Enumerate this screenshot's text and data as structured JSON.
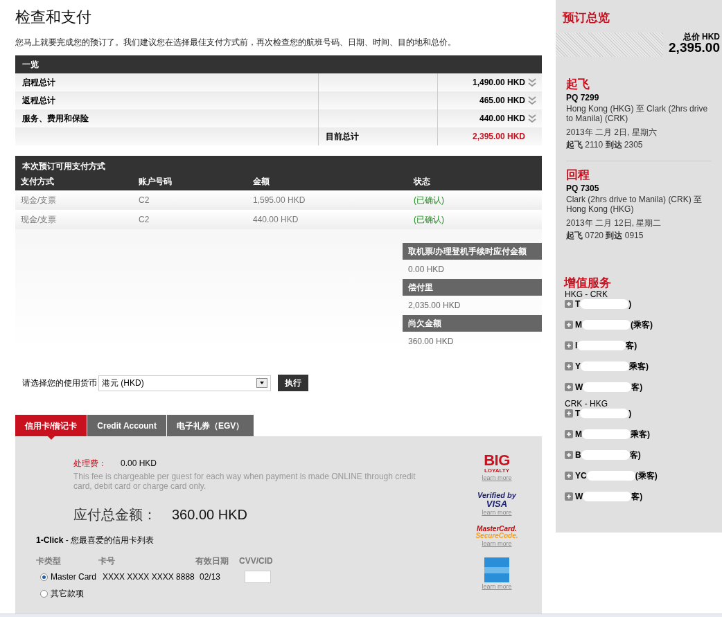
{
  "title": "检查和支付",
  "intro": "您马上就要完成您的预订了。我们建议您在选择最佳支付方式前，再次检查您的航班号码、日期、时间、目的地和总价。",
  "summary": {
    "heading": "一览",
    "rows": [
      {
        "label": "启程总计",
        "amount": "1,490.00 HKD",
        "expandable": true
      },
      {
        "label": "返程总计",
        "amount": "465.00 HKD",
        "expandable": true
      },
      {
        "label": "服务、费用和保险",
        "amount": "440.00 HKD",
        "expandable": true
      }
    ],
    "total_label": "目前总计",
    "total_amount": "2,395.00 HKD"
  },
  "payments": {
    "heading": "本次预订可用支付方式",
    "columns": [
      "支付方式",
      "账户号码",
      "金额",
      "状态"
    ],
    "rows": [
      [
        "现金/支票",
        "C2",
        "1,595.00 HKD",
        "(已确认)"
      ],
      [
        "现金/支票",
        "C2",
        "440.00 HKD",
        "(已确认)"
      ]
    ]
  },
  "dues": [
    {
      "label": "取机票/办理登机手续时应付金额",
      "value": "0.00 HKD"
    },
    {
      "label": "偿付里",
      "value": "2,035.00 HKD"
    },
    {
      "label": "尚欠金额",
      "value": "360.00 HKD"
    }
  ],
  "currency": {
    "label": "请选择您的使用货币",
    "value": "港元 (HKD)",
    "button": "执行"
  },
  "tabs": [
    {
      "label": "信用卡/借记卡",
      "selected": true
    },
    {
      "label": "Credit Account",
      "selected": false
    },
    {
      "label": "电子礼券（EGV）",
      "selected": false
    }
  ],
  "fee": {
    "label": "处理费：",
    "value": "0.00 HKD",
    "note": "This fee is chargeable per guest for each way when payment is made ONLINE through credit card, debit card or charge card only."
  },
  "total_due": {
    "label": "应付总金额：",
    "value": "360.00 HKD"
  },
  "one_click": "**1-Click** - 您最喜爱的信用卡列表",
  "card_columns": [
    "卡类型",
    "卡号",
    "有效日期",
    "CVV/CID"
  ],
  "cards": [
    {
      "kind": "card",
      "type": "Master Card",
      "number": "XXXX XXXX XXXX 8888",
      "expiry": "02/13",
      "selected": true
    },
    {
      "kind": "other",
      "type": "其它款项",
      "selected": false
    }
  ],
  "logos": [
    {
      "kind": "big",
      "lines": [
        "BIG",
        "LOYALTY"
      ],
      "link": "learn more"
    },
    {
      "kind": "visa",
      "lines": [
        "Verified by",
        "VISA"
      ],
      "link": "learn more"
    },
    {
      "kind": "mastercard",
      "lines": [
        "MasterCard.",
        "SecureCode."
      ],
      "link": "learn more"
    },
    {
      "kind": "amex",
      "link": "learn more"
    }
  ],
  "sidebar": {
    "title": "预订总览",
    "total_label": "总价",
    "currency": "HKD",
    "total": "2,395.00",
    "flights": [
      {
        "heading": "起飞",
        "number": "PQ 7299",
        "route": "Hong Kong (HKG) 至 Clark (2hrs drive to Manila) (CRK)",
        "date": "2013年 二月 2日, 星期六",
        "dep_label": "起飞",
        "dep": "2110",
        "arr_label": "到达",
        "arr": "2305"
      },
      {
        "heading": "回程",
        "number": "PQ 7305",
        "route": "Clark (2hrs drive to Manila) (CRK) 至 Hong Kong (HKG)",
        "date": "2013年 二月 12日, 星期二",
        "dep_label": "起飞",
        "dep": "0720",
        "arr_label": "到达",
        "arr": "0915"
      }
    ],
    "services_title": "增值服务",
    "segments": [
      {
        "route": "HKG - CRK",
        "passengers": [
          {
            "start": "T",
            "end": ")"
          },
          {
            "start": "M",
            "end": "(乘客)"
          },
          {
            "start": "I",
            "end": "客)"
          },
          {
            "start": "Y",
            "end": "乘客)"
          },
          {
            "start": "W",
            "end": "客)"
          }
        ]
      },
      {
        "route": "CRK - HKG",
        "passengers": [
          {
            "start": "T",
            "end": ")"
          },
          {
            "start": "M",
            "end": "乘客)"
          },
          {
            "start": "B",
            "end": "客)"
          },
          {
            "start": "YC",
            "end": "(乘客)"
          },
          {
            "start": "W",
            "end": "客)"
          }
        ]
      }
    ]
  }
}
